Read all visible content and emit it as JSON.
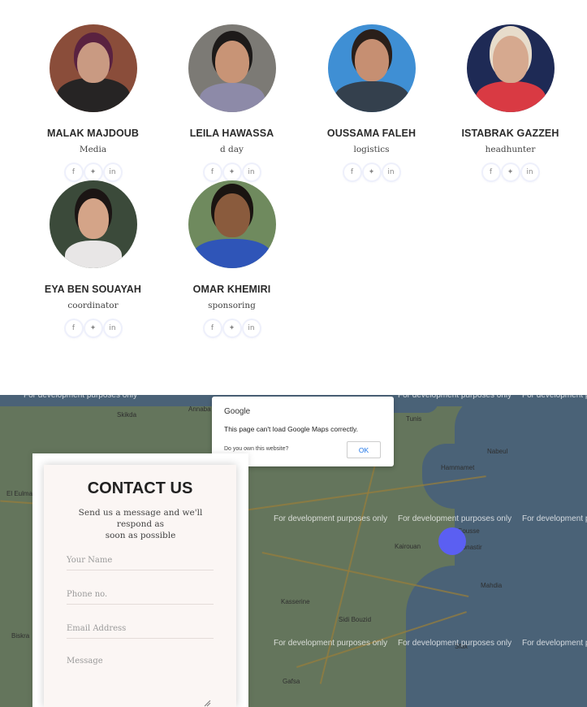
{
  "team": [
    {
      "name": "MALAK MAJDOUB",
      "role": "Media",
      "photo": {
        "bg": "#8a4d3a",
        "skin": "#c99a82",
        "hair": "#5a2240",
        "cloth": "#262424"
      }
    },
    {
      "name": "LEILA HAWASSA",
      "role": "d day",
      "photo": {
        "bg": "#7c7a75",
        "skin": "#c89476",
        "hair": "#1d1a19",
        "cloth": "#8d8aa8"
      }
    },
    {
      "name": "OUSSAMA FALEH",
      "role": "logistics",
      "photo": {
        "bg": "#3f8fd4",
        "skin": "#c68f72",
        "hair": "#2a1f1a",
        "cloth": "#34404d"
      }
    },
    {
      "name": "ISTABRAK GAZZEH",
      "role": "headhunter",
      "photo": {
        "bg": "#1e2a55",
        "skin": "#d6a98f",
        "hair": "#e7dccb",
        "cloth": "#d93a43"
      }
    },
    {
      "name": "EYA BEN SOUAYAH",
      "role": "coordinator",
      "photo": {
        "bg": "#3b4a3a",
        "skin": "#d4a488",
        "hair": "#1b1514",
        "cloth": "#e8e6e6"
      }
    },
    {
      "name": "OMAR KHEMIRI",
      "role": "sponsoring",
      "photo": {
        "bg": "#6f8a5e",
        "skin": "#8a5b3d",
        "hair": "#1a1411",
        "cloth": "#2f55b8"
      }
    }
  ],
  "socials": [
    "f",
    "🐦",
    "in"
  ],
  "map": {
    "watermark": "For development purposes only",
    "towns": [
      "Tunis",
      "Kairouan",
      "Sousse",
      "Monastir",
      "Mahdia",
      "Kasserine",
      "Sfax",
      "Gafsa",
      "Hammamet",
      "Nabeul",
      "Skikda",
      "Annaba",
      "El Eulma",
      "Sidi Bouzid",
      "Biskra"
    ],
    "dialog": {
      "brand": "Google",
      "message": "This page can't load Google Maps correctly.",
      "own_site": "Do you own this website?",
      "ok_label": "OK"
    },
    "marker_color": "#5b5ff2"
  },
  "contact": {
    "title": "CONTACT US",
    "subtitle_line1": "Send us a message and we'll respond as",
    "subtitle_line2": "soon as possible",
    "name_placeholder": "Your Name",
    "phone_placeholder": "Phone no.",
    "email_placeholder": "Email Address",
    "message_placeholder": "Message"
  }
}
